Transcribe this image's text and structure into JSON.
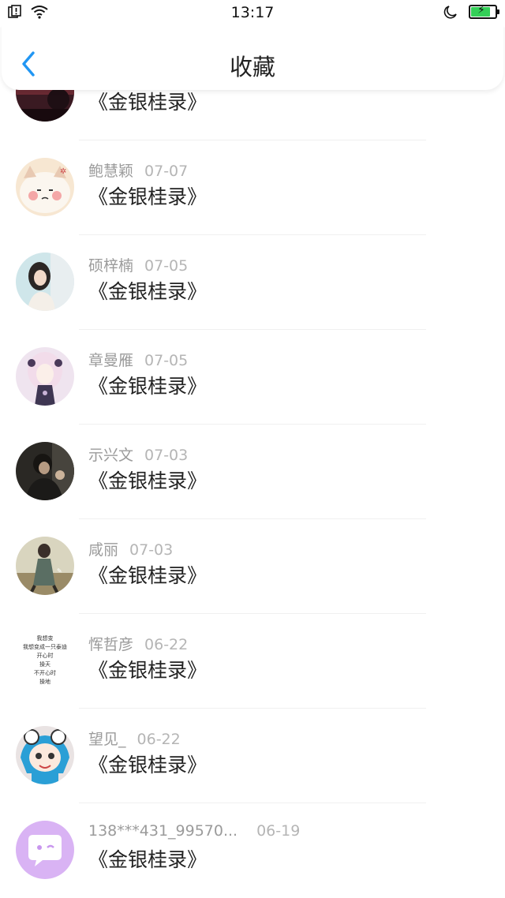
{
  "status": {
    "time": "13:17"
  },
  "header": {
    "title": "收藏"
  },
  "items": [
    {
      "user": "",
      "date": "",
      "book": "《金银桂录》"
    },
    {
      "user": "鲍慧颖",
      "date": "07-07",
      "book": "《金银桂录》"
    },
    {
      "user": "硕梓楠",
      "date": "07-05",
      "book": "《金银桂录》"
    },
    {
      "user": "章曼雁",
      "date": "07-05",
      "book": "《金银桂录》"
    },
    {
      "user": "示兴文",
      "date": "07-03",
      "book": "《金银桂录》"
    },
    {
      "user": "咸丽",
      "date": "07-03",
      "book": "《金银桂录》"
    },
    {
      "user": "恽哲彦",
      "date": "06-22",
      "book": "《金银桂录》"
    },
    {
      "user": "望见_",
      "date": "06-22",
      "book": "《金银桂录》"
    },
    {
      "user": "138***431_99570...",
      "date": "06-19",
      "book": "《金银桂录》"
    }
  ],
  "avatar7_text": [
    "我想变",
    "我想变成一只泰迪",
    "开心时",
    "操天",
    "不开心时",
    "操地"
  ],
  "colors": {
    "accent": "#2196f3",
    "battery": "#34d058"
  }
}
